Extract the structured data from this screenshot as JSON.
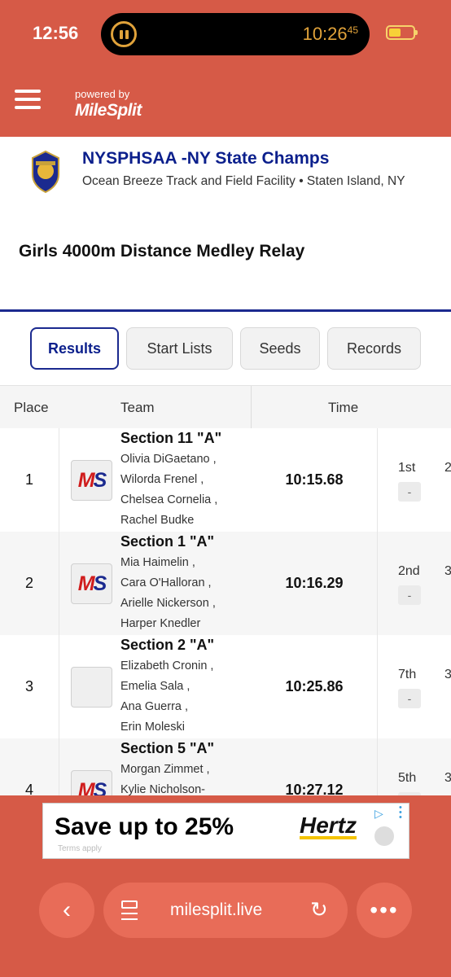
{
  "status_bar": {
    "time": "12:56",
    "activity_clock": "10:26",
    "activity_clock_seconds": "45"
  },
  "header": {
    "powered_by": "powered by",
    "brand": "MileSplit"
  },
  "meet": {
    "title": "NYSPHSAA -NY State Champs",
    "venue": "Ocean Breeze Track and Field Facility • Staten Island, NY"
  },
  "event": {
    "title": "Girls 4000m Distance Medley Relay"
  },
  "tabs": [
    {
      "label": "Results",
      "active": true
    },
    {
      "label": "Start Lists",
      "active": false
    },
    {
      "label": "Seeds",
      "active": false
    },
    {
      "label": "Records",
      "active": false
    }
  ],
  "table": {
    "headers": {
      "place": "Place",
      "team": "Team",
      "time": "Time"
    },
    "rows": [
      {
        "place": "1",
        "team": "Section 11 \"A\"",
        "athletes": [
          "Olivia DiGaetano ,",
          "Wilorda Frenel ,",
          "Chelsea Cornelia ,",
          "Rachel Budke"
        ],
        "time": "10:15.68",
        "rank": "1st",
        "badge": "-",
        "extra": "2",
        "logo": "MS"
      },
      {
        "place": "2",
        "team": "Section 1 \"A\"",
        "athletes": [
          "Mia Haimelin ,",
          "Cara O'Halloran ,",
          "Arielle Nickerson ,",
          "Harper Knedler"
        ],
        "time": "10:16.29",
        "rank": "2nd",
        "badge": "-",
        "extra": "3",
        "logo": "MS"
      },
      {
        "place": "3",
        "team": "Section 2 \"A\"",
        "athletes": [
          "Elizabeth Cronin ,",
          "Emelia Sala ,",
          "Ana Guerra ,",
          "Erin Moleski"
        ],
        "time": "10:25.86",
        "rank": "7th",
        "badge": "-",
        "extra": "3",
        "logo": ""
      },
      {
        "place": "4",
        "team": "Section 5 \"A\"",
        "athletes": [
          "Morgan Zimmet ,",
          "Kylie Nicholson-"
        ],
        "time": "10:27.12",
        "rank": "5th",
        "badge": "-",
        "extra": "3",
        "logo": "MS"
      }
    ]
  },
  "ad": {
    "headline": "Save up to 25%",
    "brand": "Hertz",
    "terms": "Terms apply"
  },
  "browser": {
    "url": "milesplit.live"
  },
  "colors": {
    "header_bg": "#d65a47",
    "accent_blue": "#1b2a8f",
    "ms_red": "#d01c1c"
  }
}
